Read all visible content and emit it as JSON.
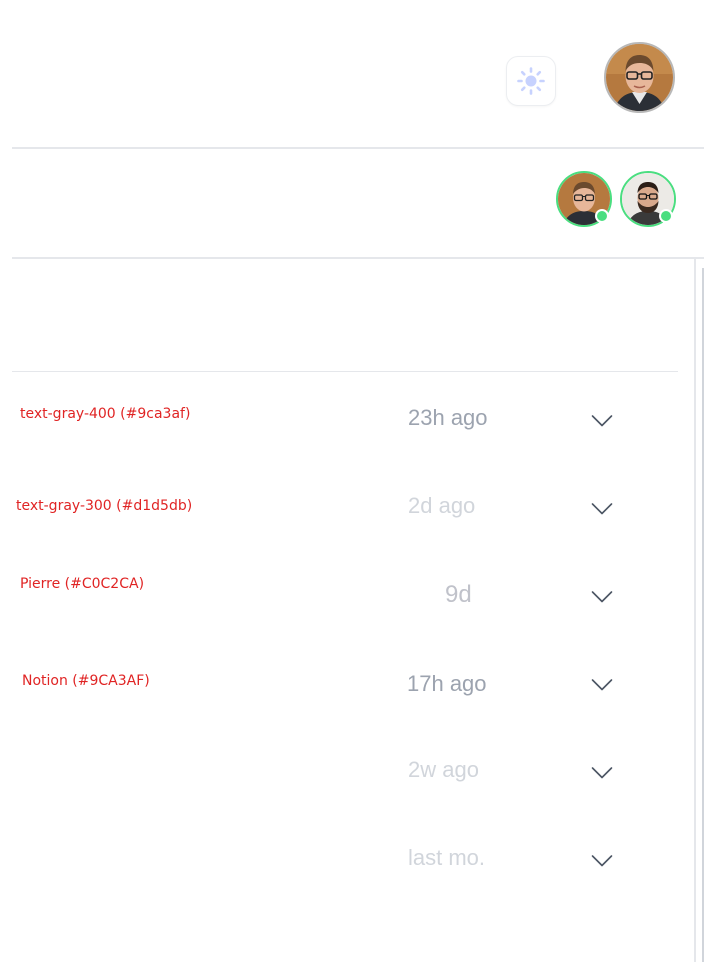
{
  "header": {
    "theme_toggle_icon": "sun-icon",
    "user_avatar_icon": "user-avatar"
  },
  "presence": {
    "status_color": "#4ade80",
    "users": [
      {
        "icon": "user-avatar-glasses",
        "status": "online"
      },
      {
        "icon": "user-avatar-beard",
        "status": "online"
      }
    ]
  },
  "colors": {
    "annotation_red": "#e02424",
    "gray_400": "#9ca3af",
    "gray_300": "#d1d5db",
    "pierre": "#C0C2CA",
    "notion": "#9CA3AF"
  },
  "rows": [
    {
      "note": "text-gray-400 (#9ca3af)",
      "time": "23h ago",
      "time_color": "#9ca3af"
    },
    {
      "note": "text-gray-300 (#d1d5db)",
      "time": "2d ago",
      "time_color": "#d1d5db"
    },
    {
      "note": "Pierre (#C0C2CA)",
      "time": "9d",
      "time_color": "#C0C2CA"
    },
    {
      "note": "Notion (#9CA3AF)",
      "time": "17h ago",
      "time_color": "#9CA3AF"
    },
    {
      "note": "",
      "time": "2w ago",
      "time_color": "#d1d5db"
    },
    {
      "note": "",
      "time": "last mo.",
      "time_color": "#d1d5db"
    }
  ],
  "row_action_icon": "chevron-down-icon"
}
